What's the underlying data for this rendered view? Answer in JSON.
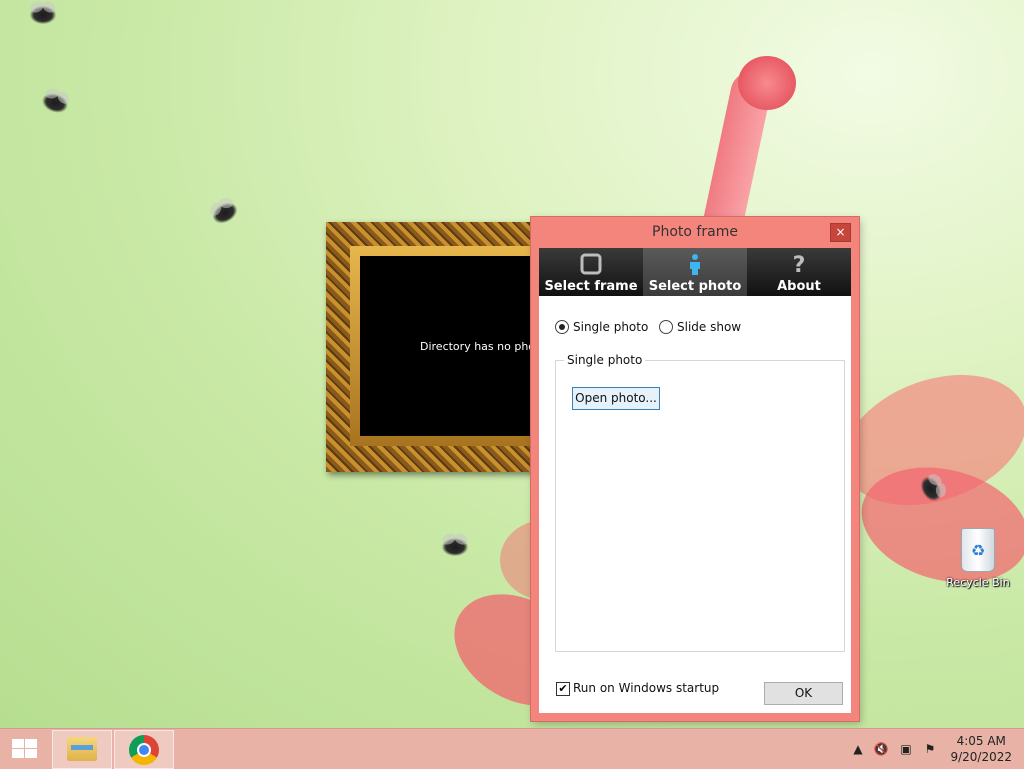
{
  "desktop": {
    "recycle_bin_label": "Recycle Bin"
  },
  "photo_frame_widget": {
    "message": "Directory has no photo"
  },
  "dialog": {
    "title": "Photo frame",
    "close_glyph": "×",
    "tabs": [
      {
        "label": "Select frame",
        "icon": "frame-icon",
        "active": false
      },
      {
        "label": "Select photo",
        "icon": "person-icon",
        "active": true
      },
      {
        "label": "About",
        "icon": "question-icon",
        "active": false
      }
    ],
    "mode": {
      "single_label": "Single photo",
      "slideshow_label": "Slide show",
      "selected": "Single photo"
    },
    "group": {
      "title": "Single photo",
      "open_button_label": "Open photo..."
    },
    "startup": {
      "label": "Run on Windows startup",
      "checked": true
    },
    "ok_label": "OK"
  },
  "taskbar": {
    "apps": [
      "File Explorer",
      "Google Chrome"
    ],
    "clock": {
      "time": "4:05 AM",
      "date": "9/20/2022"
    },
    "tray_icons": [
      "show-hidden-icons-icon",
      "volume-muted-icon",
      "network-icon",
      "action-center-icon"
    ]
  },
  "colors": {
    "dialog_accent": "#f4857c",
    "taskbar": "#e8b3a6"
  }
}
